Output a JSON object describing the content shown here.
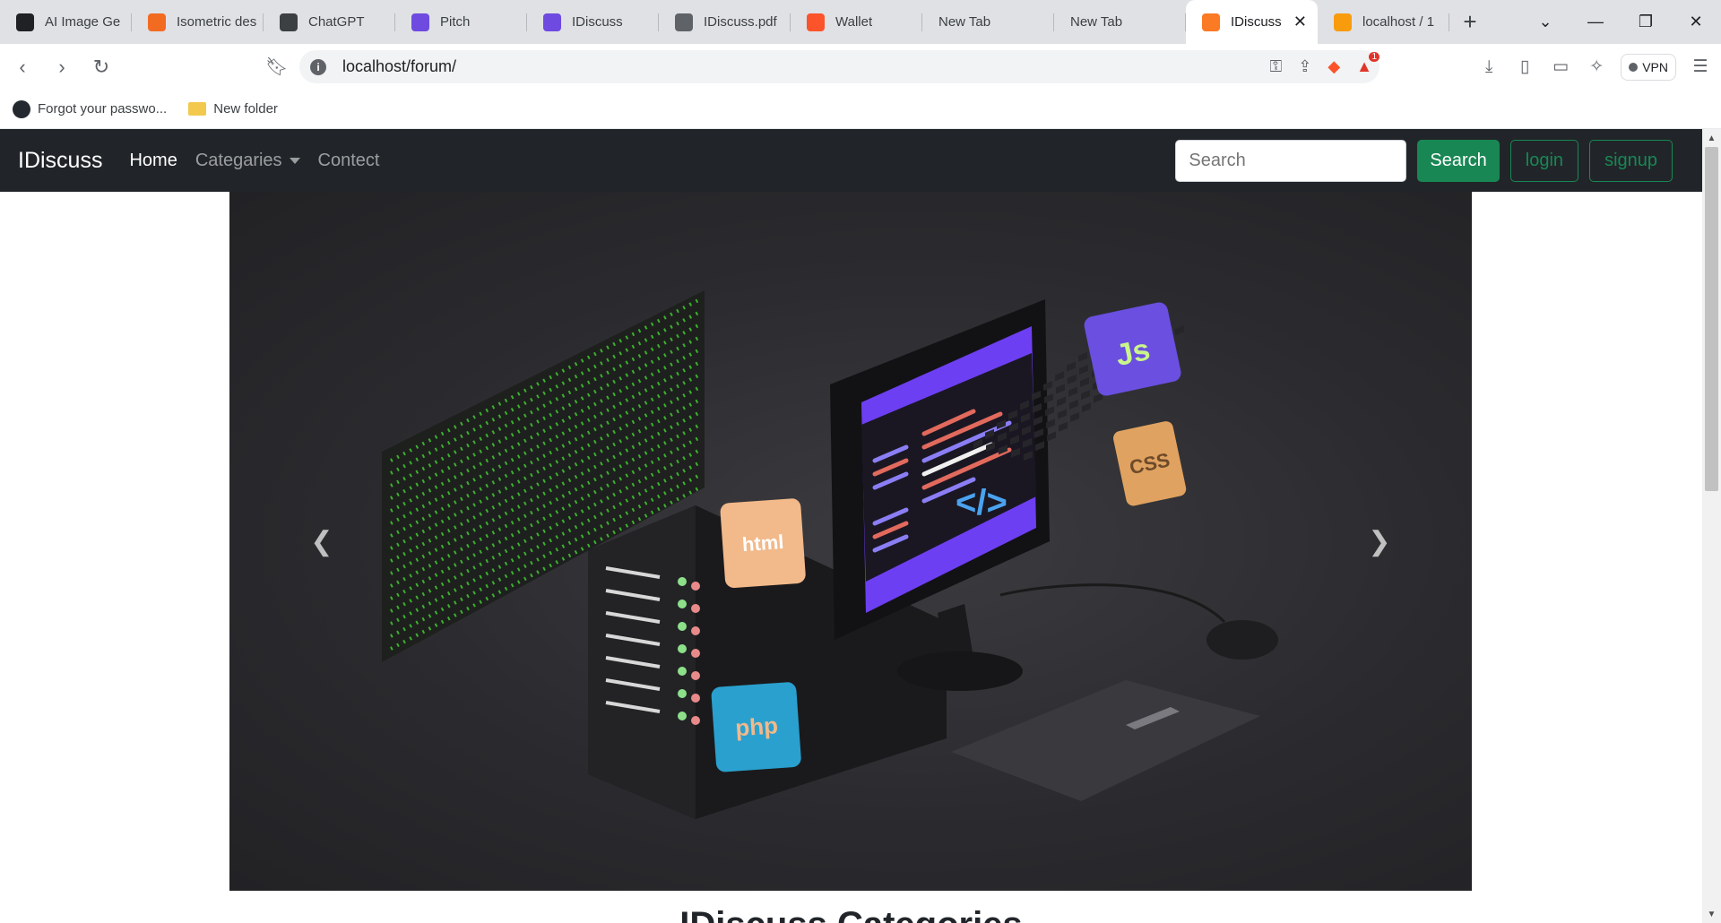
{
  "browser": {
    "tabs": [
      {
        "label": "AI Image Ge",
        "icon": "ai-image-icon",
        "color": "#202124"
      },
      {
        "label": "Isometric des",
        "icon": "isometric-icon",
        "color": "#f26b21"
      },
      {
        "label": "ChatGPT",
        "icon": "chatgpt-icon",
        "color": "#3c4043"
      },
      {
        "label": "Pitch",
        "icon": "pitch-icon",
        "color": "#6e4ae0"
      },
      {
        "label": "IDiscuss",
        "icon": "pitch-icon",
        "color": "#6e4ae0"
      },
      {
        "label": "IDiscuss.pdf",
        "icon": "globe-icon",
        "color": "#5f6368"
      },
      {
        "label": "Wallet",
        "icon": "brave-icon",
        "color": "#fb542b"
      },
      {
        "label": "New Tab",
        "icon": "",
        "color": ""
      },
      {
        "label": "New Tab",
        "icon": "",
        "color": ""
      },
      {
        "label": "IDiscuss",
        "icon": "xampp-icon",
        "color": "#fb7a24",
        "active": true
      },
      {
        "label": "localhost / 1",
        "icon": "phpmyadmin-icon",
        "color": "#f89c0e"
      }
    ],
    "url": "localhost/forum/",
    "vpn_label": "VPN",
    "shields_count": "1",
    "bookmarks": [
      {
        "label": "Forgot your passwo...",
        "icon": "github-icon"
      },
      {
        "label": "New folder",
        "icon": "folder-icon"
      }
    ]
  },
  "site": {
    "brand": "IDiscuss",
    "nav": {
      "home": "Home",
      "categories": "Categaries",
      "contact": "Contect"
    },
    "search_placeholder": "Search",
    "search_button": "Search",
    "login_button": "login",
    "signup_button": "signup"
  },
  "carousel": {
    "badges": {
      "js": "Js",
      "css": "CSS",
      "html": "html",
      "php": "php"
    },
    "code_glyph": "</>"
  },
  "section_heading": "IDiscuss Categories"
}
